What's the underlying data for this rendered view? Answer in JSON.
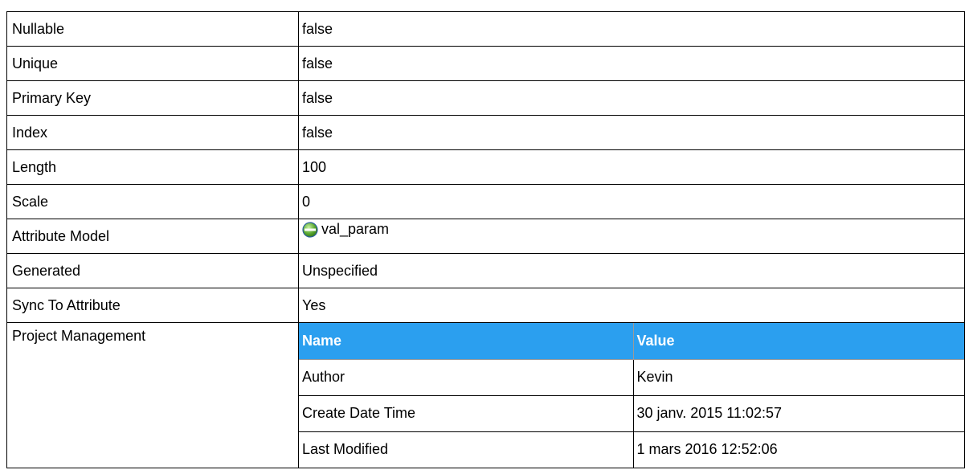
{
  "properties": [
    {
      "label": "Nullable",
      "value": "false"
    },
    {
      "label": "Unique",
      "value": "false"
    },
    {
      "label": "Primary Key",
      "value": "false"
    },
    {
      "label": "Index",
      "value": "false"
    },
    {
      "label": "Length",
      "value": "100"
    },
    {
      "label": "Scale",
      "value": "0"
    },
    {
      "label": "Attribute Model",
      "value": "val_param",
      "icon": "attribute-model-icon"
    },
    {
      "label": "Generated",
      "value": "Unspecified"
    },
    {
      "label": "Sync To Attribute",
      "value": "Yes"
    }
  ],
  "project_management": {
    "label": "Project Management",
    "columns": [
      "Name",
      "Value"
    ],
    "rows": [
      {
        "name": "Author",
        "value": "Kevin"
      },
      {
        "name": "Create Date Time",
        "value": "30 janv. 2015 11:02:57"
      },
      {
        "name": "Last Modified",
        "value": "1 mars 2016 12:52:06"
      }
    ]
  },
  "colors": {
    "header_bg": "#2b9fef",
    "header_text": "#ffffff",
    "icon_fill": "#5aa832"
  }
}
